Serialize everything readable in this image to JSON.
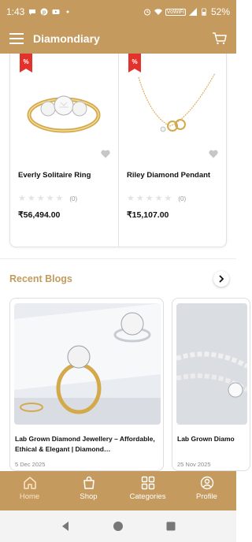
{
  "status_bar": {
    "time": "1:43",
    "volte": "VoWiFi",
    "battery": "52%"
  },
  "header": {
    "title": "Diamondiary",
    "menu_icon": "hamburger-menu-icon",
    "cart_icon": "cart-icon"
  },
  "products": [
    {
      "discount": "%",
      "name": "Everly Solitaire Ring",
      "rating_count": "(0)",
      "price": "₹56,494.00",
      "stars": [
        "★",
        "★",
        "★",
        "★",
        "★"
      ]
    },
    {
      "discount": "%",
      "name": "Riley Diamond Pendant",
      "rating_count": "(0)",
      "price": "₹15,107.00",
      "stars": [
        "★",
        "★",
        "★",
        "★",
        "★"
      ]
    }
  ],
  "blogs_section": {
    "title": "Recent Blogs",
    "next_icon": "chevron-right-icon"
  },
  "blogs": [
    {
      "title": "Lab Grown Diamond Jewellery – Affordable, Ethical & Elegant | Diamond…",
      "date": "5 Dec 2025"
    },
    {
      "title": "Lab Grown Diamo",
      "date": "25 Nov 2025"
    }
  ],
  "bottom_nav": [
    {
      "label": "Home",
      "icon": "home-icon",
      "active": true
    },
    {
      "label": "Shop",
      "icon": "shopping-bag-icon",
      "active": false
    },
    {
      "label": "Categories",
      "icon": "grid-icon",
      "active": false
    },
    {
      "label": "Profile",
      "icon": "user-icon",
      "active": false
    }
  ],
  "colors": {
    "brand": "#c49a5e",
    "discount": "#e3322b",
    "active_nav": "#fbe6c7"
  }
}
